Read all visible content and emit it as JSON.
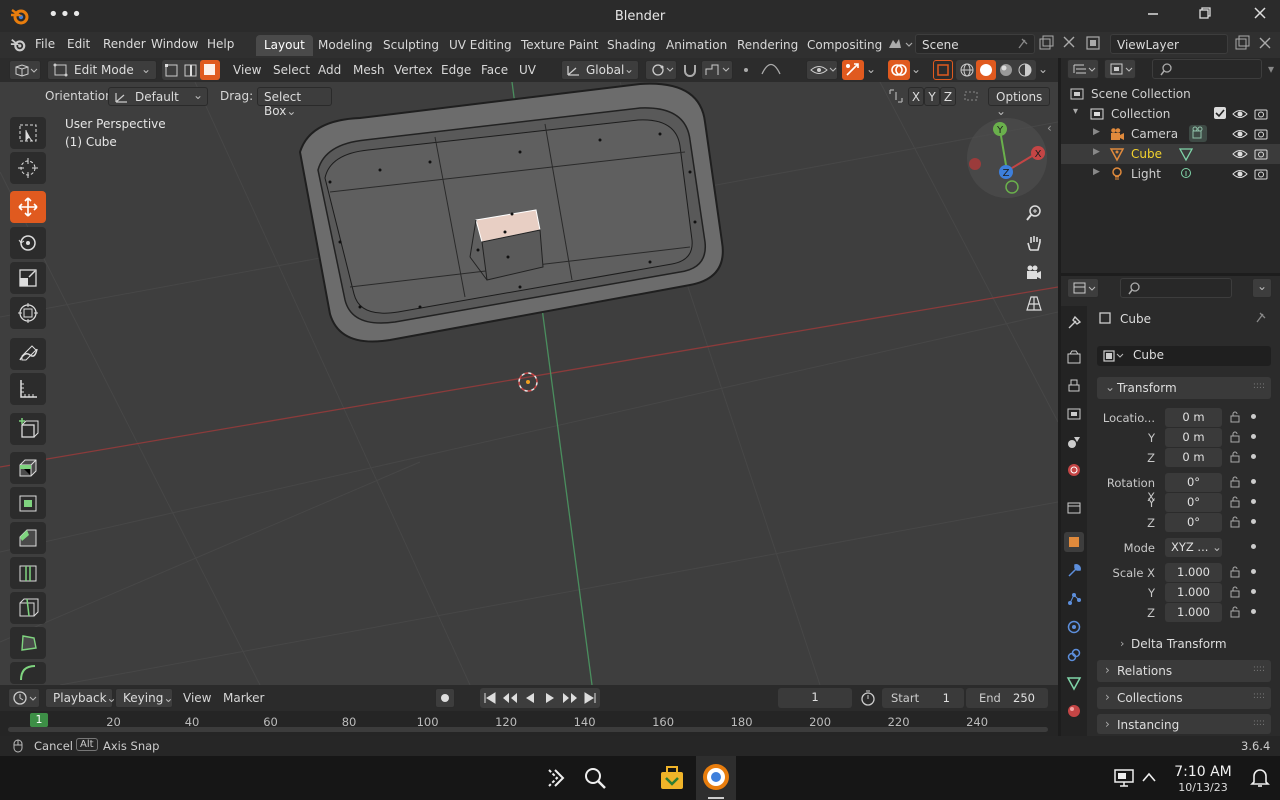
{
  "window": {
    "title": "Blender"
  },
  "menubar": {
    "items": [
      "File",
      "Edit",
      "Render",
      "Window",
      "Help"
    ]
  },
  "workspaces": [
    "Layout",
    "Modeling",
    "Sculpting",
    "UV Editing",
    "Texture Paint",
    "Shading",
    "Animation",
    "Rendering",
    "Compositing"
  ],
  "scene": {
    "label": "Scene"
  },
  "view_layer": {
    "label": "ViewLayer"
  },
  "viewport_header": {
    "mode": "Edit Mode",
    "menus": [
      "View",
      "Select",
      "Add",
      "Mesh",
      "Vertex",
      "Edge",
      "Face",
      "UV"
    ],
    "transform_orientation": "Global"
  },
  "tool_settings": {
    "orientation_label": "Orientation:",
    "orientation_value": "Default",
    "drag_label": "Drag:",
    "drag_value": "Select Box",
    "axes": [
      "X",
      "Y",
      "Z"
    ],
    "options_label": "Options"
  },
  "viewport": {
    "perspective_label": "User Perspective",
    "object_label": "(1) Cube"
  },
  "gizmo": {
    "x": "X",
    "y": "Y",
    "z": "Z"
  },
  "outliner": {
    "root": "Scene Collection",
    "collection": "Collection",
    "items": [
      {
        "name": "Camera",
        "selected": false
      },
      {
        "name": "Cube",
        "selected": true
      },
      {
        "name": "Light",
        "selected": false
      }
    ]
  },
  "properties": {
    "object_name": "Cube",
    "data_name": "Cube",
    "transform_header": "Transform",
    "location_label": "Locatio...",
    "location": [
      "0 m",
      "0 m",
      "0 m"
    ],
    "rotation_label": "Rotation X",
    "rotation": [
      "0°",
      "0°",
      "0°"
    ],
    "mode_label": "Mode",
    "mode_value": "XYZ ...",
    "scale_label": "Scale X",
    "scale": [
      "1.000",
      "1.000",
      "1.000"
    ],
    "axis_y": "Y",
    "axis_z": "Z",
    "delta_transform": "Delta Transform",
    "panels": [
      "Relations",
      "Collections",
      "Instancing"
    ]
  },
  "timeline": {
    "menus": [
      "Playback",
      "Keying",
      "View",
      "Marker"
    ],
    "current_frame": "1",
    "start_label": "Start",
    "start": "1",
    "end_label": "End",
    "end": "250",
    "ruler": [
      "1",
      "20",
      "40",
      "60",
      "80",
      "100",
      "120",
      "140",
      "160",
      "180",
      "200",
      "220",
      "240"
    ]
  },
  "statusbar": {
    "cancel": "Cancel",
    "alt_key": "Alt",
    "axis_snap": "Axis Snap",
    "version": "3.6.4"
  },
  "taskbar": {
    "time": "7:10 AM",
    "date": "10/13/23"
  },
  "colors": {
    "accent": "#e05a1f",
    "selected_text": "#f2d22e",
    "axis_x": "#c44545",
    "axis_y": "#6ab04c",
    "axis_z": "#3d7fdc"
  }
}
